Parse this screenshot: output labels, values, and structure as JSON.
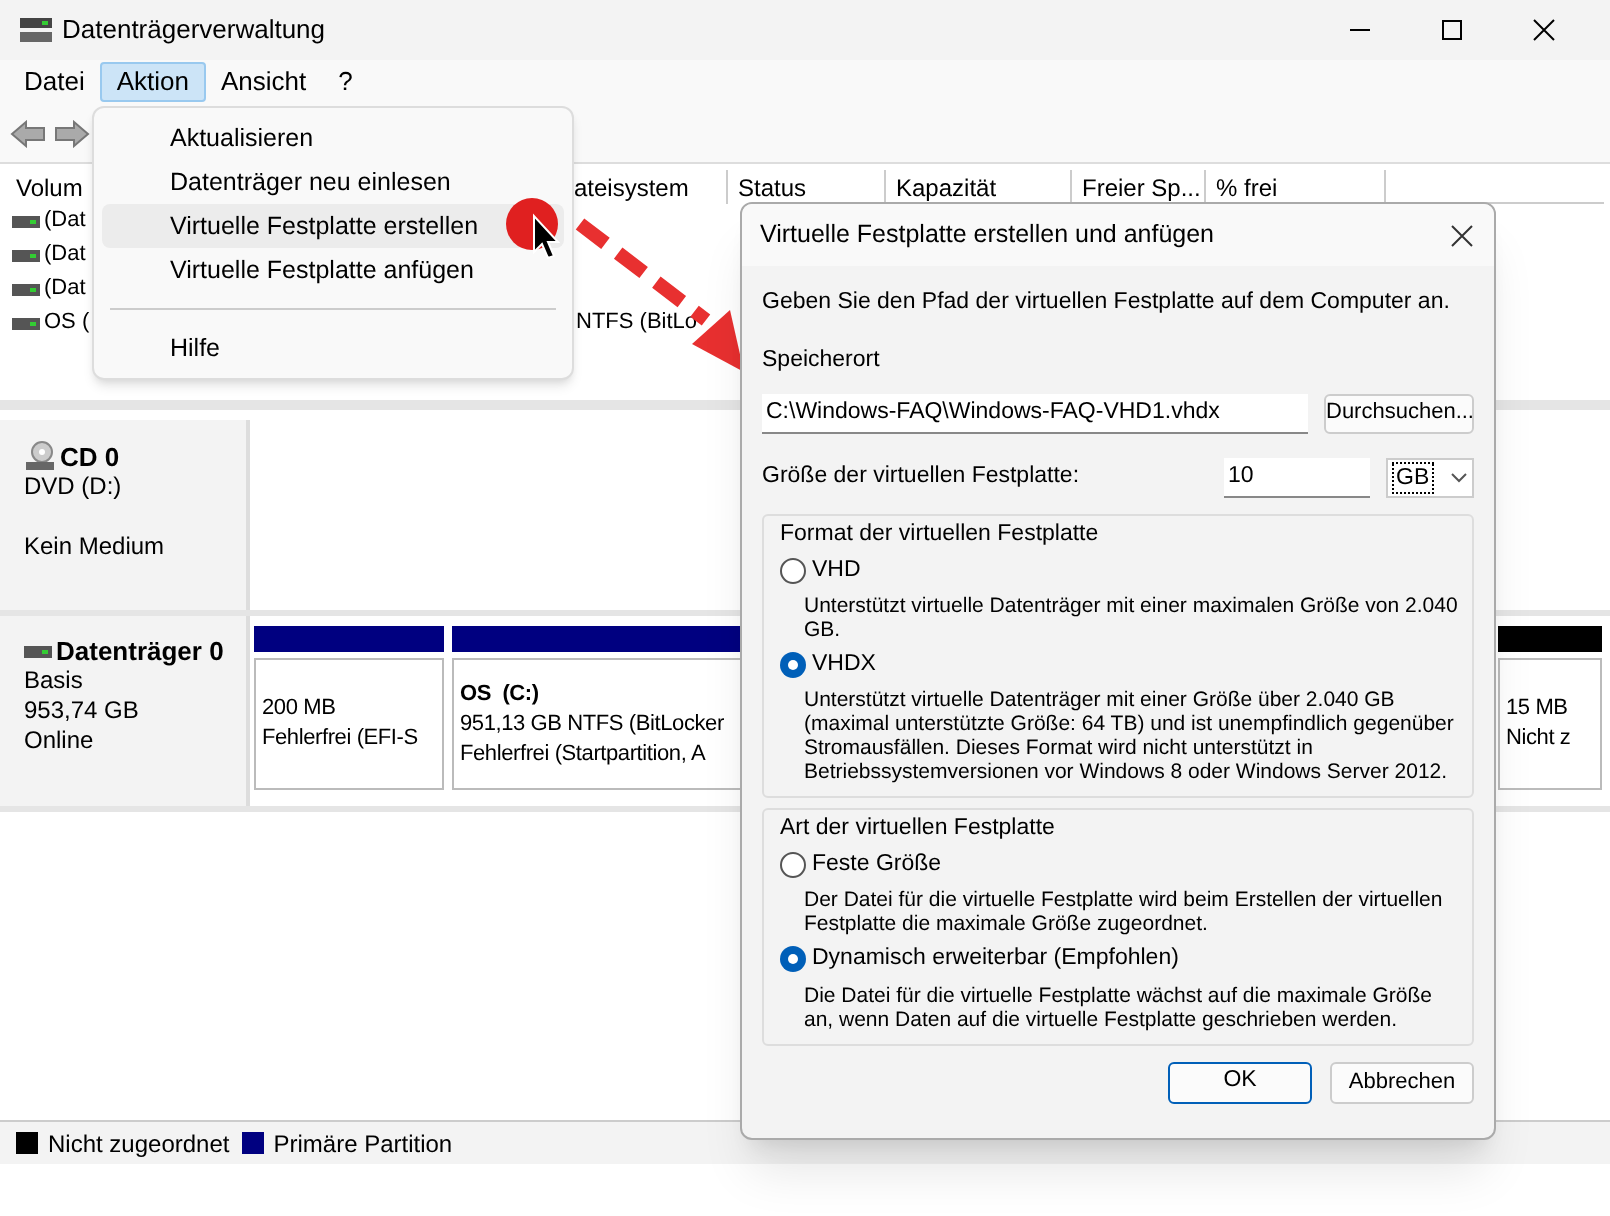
{
  "window": {
    "title": "Datenträgerverwaltung"
  },
  "menu_bar": [
    {
      "label": "Datei",
      "selected": false
    },
    {
      "label": "Aktion",
      "selected": true
    },
    {
      "label": "Ansicht",
      "selected": false
    },
    {
      "label": "?",
      "selected": false
    }
  ],
  "menu": {
    "items": [
      {
        "kind": "item",
        "label": "Aktualisieren",
        "selected": false
      },
      {
        "kind": "item",
        "label": "Datenträger neu einlesen",
        "selected": false
      },
      {
        "kind": "item",
        "label": "Virtuelle Festplatte erstellen",
        "selected": true
      },
      {
        "kind": "item",
        "label": "Virtuelle Festplatte anfügen",
        "selected": false
      },
      {
        "kind": "separator"
      },
      {
        "kind": "item",
        "label": "Hilfe",
        "selected": false
      }
    ]
  },
  "volume_table": {
    "columns": [
      "Volum",
      "ateisystem",
      "Status",
      "Kapazität",
      "Freier Sp...",
      "% frei"
    ],
    "rows": [
      {
        "volume": "(Dat"
      },
      {
        "volume": "(Dat"
      },
      {
        "volume": "(Dat"
      },
      {
        "volume": "OS (",
        "file_system": "NTFS (BitLo"
      }
    ]
  },
  "disks": [
    {
      "kind": "cd",
      "name": "CD 0",
      "lines": [
        "DVD (D:)",
        "Kein Medium"
      ]
    },
    {
      "kind": "disk",
      "name": "Datenträger 0",
      "lines": [
        "Basis",
        "953,74 GB",
        "Online"
      ],
      "partitions": [
        {
          "color": "#000080",
          "size": "200 MB",
          "status": "Fehlerfrei (EFI-S"
        },
        {
          "color": "#000080",
          "name": "OS  (C:)",
          "size": "951,13 GB NTFS (BitLocker",
          "status": "Fehlerfrei (Startpartition, A"
        },
        {
          "color": "#000000",
          "size": "15 MB",
          "status": "Nicht z"
        }
      ]
    }
  ],
  "legend": [
    {
      "color": "#000000",
      "label": "Nicht zugeordnet"
    },
    {
      "color": "#000080",
      "label": "Primäre Partition"
    }
  ],
  "dialog": {
    "title": "Virtuelle Festplatte erstellen und anfügen",
    "instruction": "Geben Sie den Pfad der virtuellen Festplatte auf dem Computer an.",
    "location_label": "Speicherort",
    "location_value": "C:\\Windows-FAQ\\Windows-FAQ-VHD1.vhdx",
    "browse_button": "Durchsuchen...",
    "size_label": "Größe der virtuellen Festplatte:",
    "size_value": "10",
    "unit": "GB",
    "groups": [
      {
        "title": "Format der virtuellen Festplatte",
        "options": [
          {
            "label": "VHD",
            "selected": false,
            "description": "Unterstützt virtuelle Datenträger mit einer maximalen Größe von 2.040 GB."
          },
          {
            "label": "VHDX",
            "selected": true,
            "description": "Unterstützt virtuelle Datenträger mit einer Größe über 2.040 GB (maximal unterstützte Größe: 64 TB) und ist unempfindlich gegenüber Stromausfällen. Dieses Format wird nicht unterstützt in Betriebssystemversionen vor Windows 8 oder Windows Server 2012."
          }
        ]
      },
      {
        "title": "Art der virtuellen Festplatte",
        "options": [
          {
            "label": "Feste Größe",
            "selected": false,
            "description": "Der Datei für die virtuelle Festplatte wird beim Erstellen der virtuellen Festplatte die maximale Größe zugeordnet."
          },
          {
            "label": "Dynamisch erweiterbar (Empfohlen)",
            "selected": true,
            "description": "Die Datei für die virtuelle Festplatte wächst auf die maximale Größe an, wenn Daten auf die virtuelle Festplatte geschrieben werden."
          }
        ]
      }
    ],
    "buttons": [
      {
        "label": "OK",
        "default": true
      },
      {
        "label": "Abbrechen",
        "default": false
      }
    ]
  }
}
